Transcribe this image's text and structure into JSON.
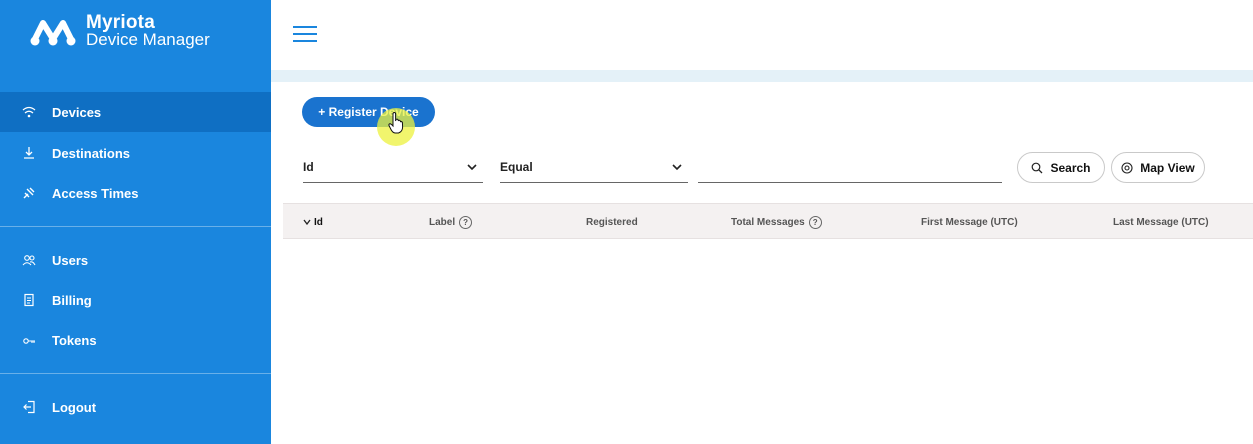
{
  "brand": {
    "name": "Myriota",
    "subtitle": "Device Manager"
  },
  "sidebar": {
    "items": [
      {
        "label": "Devices",
        "icon": "wifi-icon",
        "active": true
      },
      {
        "label": "Destinations",
        "icon": "download-icon",
        "active": false
      },
      {
        "label": "Access Times",
        "icon": "satellite-icon",
        "active": false
      },
      {
        "label": "Users",
        "icon": "users-icon",
        "active": false
      },
      {
        "label": "Billing",
        "icon": "receipt-icon",
        "active": false
      },
      {
        "label": "Tokens",
        "icon": "key-icon",
        "active": false
      },
      {
        "label": "Logout",
        "icon": "logout-icon",
        "active": false
      }
    ]
  },
  "toolbar": {
    "register_label": "+ Register Device"
  },
  "filters": {
    "field_select": "Id",
    "operator_select": "Equal",
    "value_input": "",
    "search_label": "Search",
    "map_view_label": "Map View"
  },
  "table": {
    "columns": [
      "Id",
      "Label",
      "Registered",
      "Total Messages",
      "First Message (UTC)",
      "Last Message (UTC)"
    ],
    "help_glyph": "?",
    "rows": []
  },
  "colors": {
    "sidebar": "#1a86de",
    "sidebar_active": "#0f6fc3",
    "primary_button": "#1a73cf",
    "content_band": "#e4f1f8",
    "table_header": "#f4f1f1",
    "cursor_highlight": "#ecf13c"
  }
}
